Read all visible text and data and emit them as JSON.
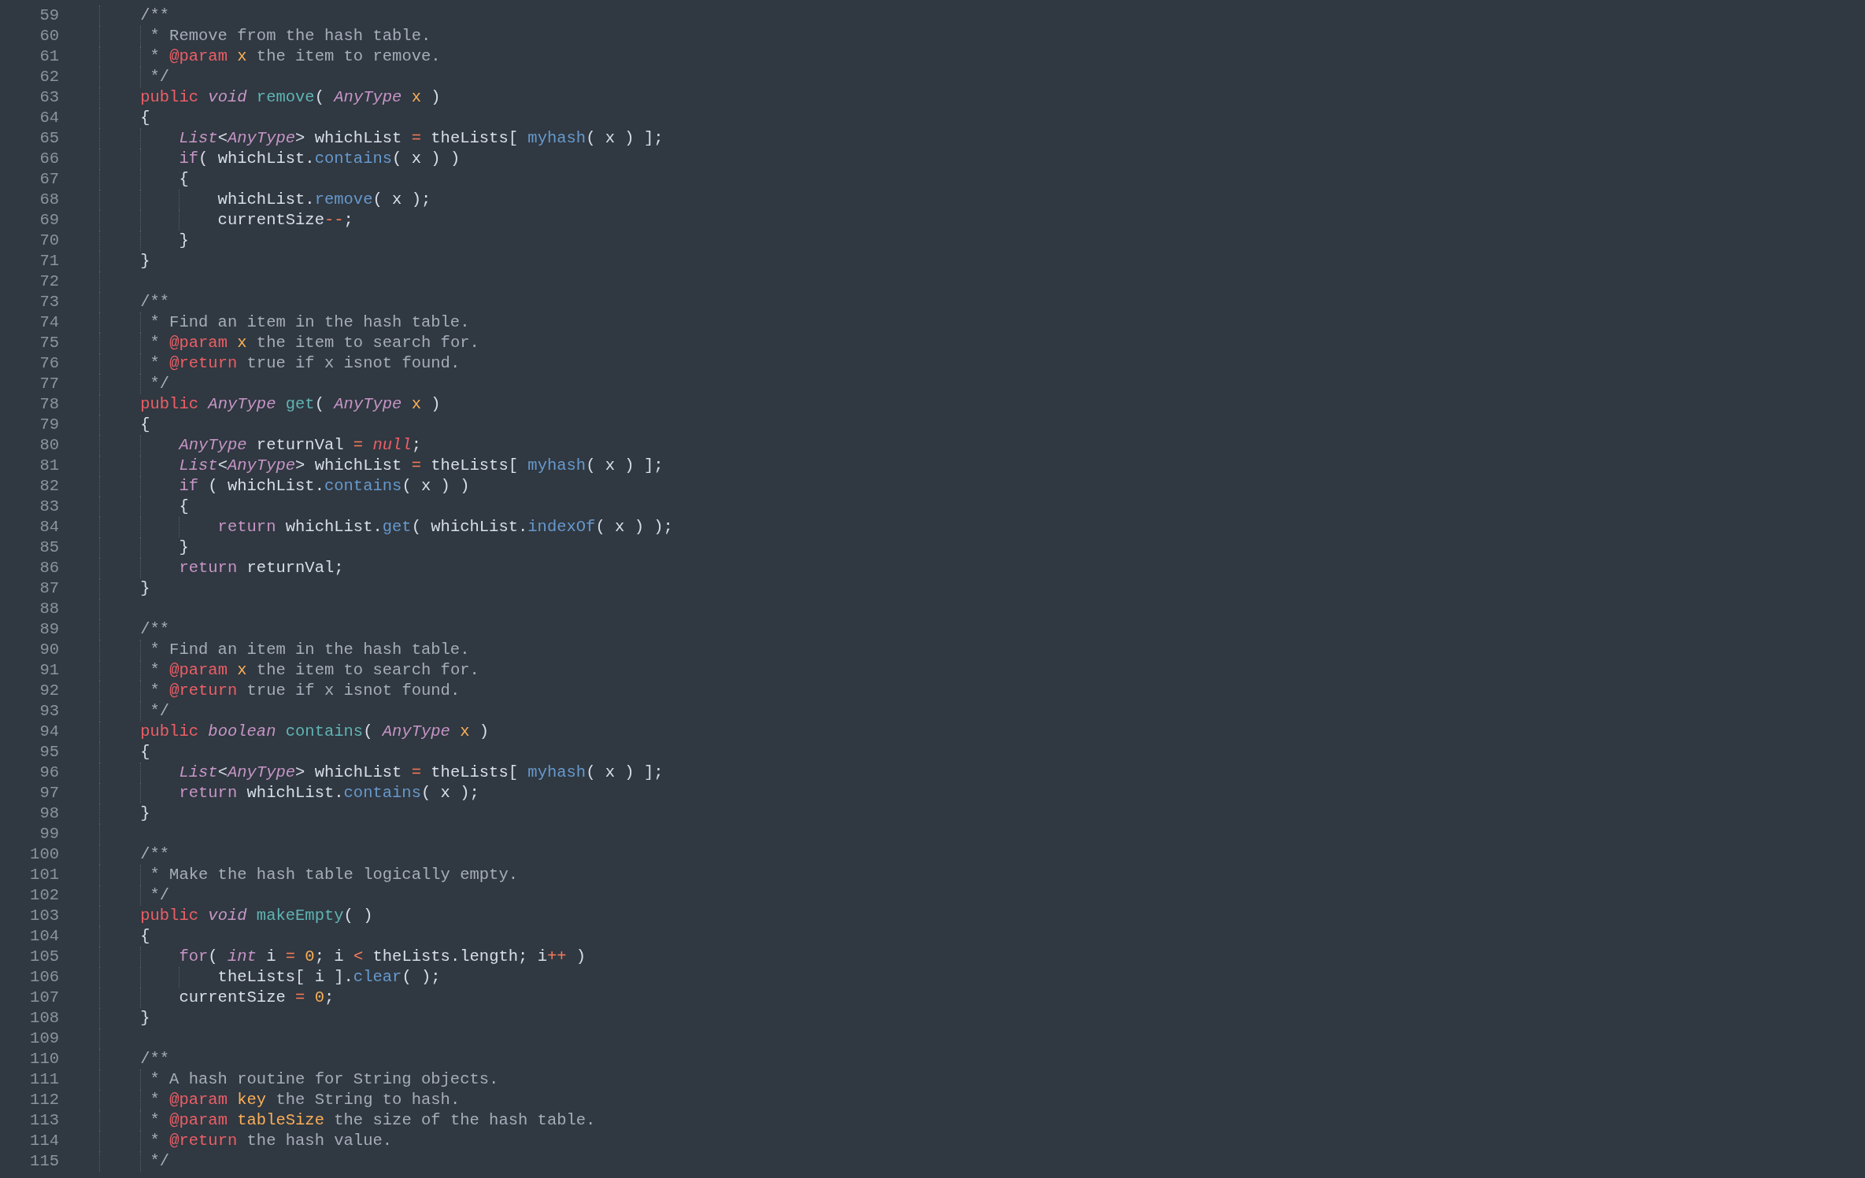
{
  "editor": {
    "lines": [
      {
        "number": "59",
        "tokens": [
          {
            "text": "    /**",
            "kind": "comment"
          }
        ]
      },
      {
        "number": "60",
        "tokens": [
          {
            "text": "     * Remove from the hash table.",
            "kind": "comment"
          }
        ]
      },
      {
        "number": "61",
        "tokens": [
          {
            "text": "     * ",
            "kind": "comment"
          },
          {
            "text": "@param",
            "kind": "tag"
          },
          {
            "text": " x",
            "kind": "param"
          },
          {
            "text": " the item to remove.",
            "kind": "comment"
          }
        ]
      },
      {
        "number": "62",
        "tokens": [
          {
            "text": "     */",
            "kind": "comment"
          }
        ]
      },
      {
        "number": "63",
        "tokens": [
          {
            "text": "    public",
            "kind": "modifier"
          },
          {
            "text": " void",
            "kind": "type"
          },
          {
            "text": " remove",
            "kind": "function"
          },
          {
            "text": "( ",
            "kind": "plain"
          },
          {
            "text": "AnyType",
            "kind": "type"
          },
          {
            "text": " x",
            "kind": "param"
          },
          {
            "text": " )",
            "kind": "plain"
          }
        ]
      },
      {
        "number": "64",
        "tokens": [
          {
            "text": "    {",
            "kind": "plain"
          }
        ]
      },
      {
        "number": "65",
        "tokens": [
          {
            "text": "        List",
            "kind": "type"
          },
          {
            "text": "<",
            "kind": "plain"
          },
          {
            "text": "AnyType",
            "kind": "type"
          },
          {
            "text": "> whichList ",
            "kind": "plain"
          },
          {
            "text": "=",
            "kind": "operator"
          },
          {
            "text": " theLists[ ",
            "kind": "plain"
          },
          {
            "text": "myhash",
            "kind": "method"
          },
          {
            "text": "( x ) ];",
            "kind": "plain"
          }
        ]
      },
      {
        "number": "66",
        "tokens": [
          {
            "text": "        if",
            "kind": "keyword"
          },
          {
            "text": "( whichList.",
            "kind": "plain"
          },
          {
            "text": "contains",
            "kind": "method"
          },
          {
            "text": "( x ) )",
            "kind": "plain"
          }
        ]
      },
      {
        "number": "67",
        "tokens": [
          {
            "text": "        {",
            "kind": "plain"
          }
        ]
      },
      {
        "number": "68",
        "tokens": [
          {
            "text": "            whichList.",
            "kind": "plain"
          },
          {
            "text": "remove",
            "kind": "method"
          },
          {
            "text": "( x );",
            "kind": "plain"
          }
        ]
      },
      {
        "number": "69",
        "tokens": [
          {
            "text": "            currentSize",
            "kind": "plain"
          },
          {
            "text": "--",
            "kind": "operator"
          },
          {
            "text": ";",
            "kind": "plain"
          }
        ]
      },
      {
        "number": "70",
        "tokens": [
          {
            "text": "        }",
            "kind": "plain"
          }
        ]
      },
      {
        "number": "71",
        "tokens": [
          {
            "text": "    }",
            "kind": "plain"
          }
        ]
      },
      {
        "number": "72"
      },
      {
        "number": "73",
        "tokens": [
          {
            "text": "    /**",
            "kind": "comment"
          }
        ]
      },
      {
        "number": "74",
        "tokens": [
          {
            "text": "     * Find an item in the hash table.",
            "kind": "comment"
          }
        ]
      },
      {
        "number": "75",
        "tokens": [
          {
            "text": "     * ",
            "kind": "comment"
          },
          {
            "text": "@param",
            "kind": "tag"
          },
          {
            "text": " x",
            "kind": "param"
          },
          {
            "text": " the item to search for.",
            "kind": "comment"
          }
        ]
      },
      {
        "number": "76",
        "tokens": [
          {
            "text": "     * ",
            "kind": "comment"
          },
          {
            "text": "@return",
            "kind": "tag"
          },
          {
            "text": " true if x isnot found.",
            "kind": "comment"
          }
        ]
      },
      {
        "number": "77",
        "tokens": [
          {
            "text": "     */",
            "kind": "comment"
          }
        ]
      },
      {
        "number": "78",
        "tokens": [
          {
            "text": "    public",
            "kind": "modifier"
          },
          {
            "text": " AnyType",
            "kind": "type"
          },
          {
            "text": " get",
            "kind": "function"
          },
          {
            "text": "( ",
            "kind": "plain"
          },
          {
            "text": "AnyType",
            "kind": "type"
          },
          {
            "text": " x",
            "kind": "param"
          },
          {
            "text": " )",
            "kind": "plain"
          }
        ]
      },
      {
        "number": "79",
        "tokens": [
          {
            "text": "    {",
            "kind": "plain"
          }
        ]
      },
      {
        "number": "80",
        "tokens": [
          {
            "text": "        AnyType",
            "kind": "type"
          },
          {
            "text": " returnVal ",
            "kind": "plain"
          },
          {
            "text": "=",
            "kind": "operator"
          },
          {
            "text": " null",
            "kind": "constant"
          },
          {
            "text": ";",
            "kind": "plain"
          }
        ]
      },
      {
        "number": "81",
        "tokens": [
          {
            "text": "        List",
            "kind": "type"
          },
          {
            "text": "<",
            "kind": "plain"
          },
          {
            "text": "AnyType",
            "kind": "type"
          },
          {
            "text": "> whichList ",
            "kind": "plain"
          },
          {
            "text": "=",
            "kind": "operator"
          },
          {
            "text": " theLists[ ",
            "kind": "plain"
          },
          {
            "text": "myhash",
            "kind": "method"
          },
          {
            "text": "( x ) ];",
            "kind": "plain"
          }
        ]
      },
      {
        "number": "82",
        "tokens": [
          {
            "text": "        if",
            "kind": "keyword"
          },
          {
            "text": " ( whichList.",
            "kind": "plain"
          },
          {
            "text": "contains",
            "kind": "method"
          },
          {
            "text": "( x ) )",
            "kind": "plain"
          }
        ]
      },
      {
        "number": "83",
        "tokens": [
          {
            "text": "        {",
            "kind": "plain"
          }
        ]
      },
      {
        "number": "84",
        "tokens": [
          {
            "text": "            return",
            "kind": "keyword"
          },
          {
            "text": " whichList.",
            "kind": "plain"
          },
          {
            "text": "get",
            "kind": "method"
          },
          {
            "text": "( whichList.",
            "kind": "plain"
          },
          {
            "text": "indexOf",
            "kind": "method"
          },
          {
            "text": "( x ) );",
            "kind": "plain"
          }
        ]
      },
      {
        "number": "85",
        "tokens": [
          {
            "text": "        }",
            "kind": "plain"
          }
        ]
      },
      {
        "number": "86",
        "tokens": [
          {
            "text": "        return",
            "kind": "keyword"
          },
          {
            "text": " returnVal;",
            "kind": "plain"
          }
        ]
      },
      {
        "number": "87",
        "tokens": [
          {
            "text": "    }",
            "kind": "plain"
          }
        ]
      },
      {
        "number": "88"
      },
      {
        "number": "89",
        "tokens": [
          {
            "text": "    /**",
            "kind": "comment"
          }
        ]
      },
      {
        "number": "90",
        "tokens": [
          {
            "text": "     * Find an item in the hash table.",
            "kind": "comment"
          }
        ]
      },
      {
        "number": "91",
        "tokens": [
          {
            "text": "     * ",
            "kind": "comment"
          },
          {
            "text": "@param",
            "kind": "tag"
          },
          {
            "text": " x",
            "kind": "param"
          },
          {
            "text": " the item to search for.",
            "kind": "comment"
          }
        ]
      },
      {
        "number": "92",
        "tokens": [
          {
            "text": "     * ",
            "kind": "comment"
          },
          {
            "text": "@return",
            "kind": "tag"
          },
          {
            "text": " true if x isnot found.",
            "kind": "comment"
          }
        ]
      },
      {
        "number": "93",
        "tokens": [
          {
            "text": "     */",
            "kind": "comment"
          }
        ]
      },
      {
        "number": "94",
        "tokens": [
          {
            "text": "    public",
            "kind": "modifier"
          },
          {
            "text": " boolean",
            "kind": "type"
          },
          {
            "text": " contains",
            "kind": "function"
          },
          {
            "text": "( ",
            "kind": "plain"
          },
          {
            "text": "AnyType",
            "kind": "type"
          },
          {
            "text": " x",
            "kind": "param"
          },
          {
            "text": " )",
            "kind": "plain"
          }
        ]
      },
      {
        "number": "95",
        "tokens": [
          {
            "text": "    {",
            "kind": "plain"
          }
        ]
      },
      {
        "number": "96",
        "tokens": [
          {
            "text": "        List",
            "kind": "type"
          },
          {
            "text": "<",
            "kind": "plain"
          },
          {
            "text": "AnyType",
            "kind": "type"
          },
          {
            "text": "> whichList ",
            "kind": "plain"
          },
          {
            "text": "=",
            "kind": "operator"
          },
          {
            "text": " theLists[ ",
            "kind": "plain"
          },
          {
            "text": "myhash",
            "kind": "method"
          },
          {
            "text": "( x ) ];",
            "kind": "plain"
          }
        ]
      },
      {
        "number": "97",
        "tokens": [
          {
            "text": "        return",
            "kind": "keyword"
          },
          {
            "text": " whichList.",
            "kind": "plain"
          },
          {
            "text": "contains",
            "kind": "method"
          },
          {
            "text": "( x );",
            "kind": "plain"
          }
        ]
      },
      {
        "number": "98",
        "tokens": [
          {
            "text": "    }",
            "kind": "plain"
          }
        ]
      },
      {
        "number": "99"
      },
      {
        "number": "100",
        "tokens": [
          {
            "text": "    /**",
            "kind": "comment"
          }
        ]
      },
      {
        "number": "101",
        "tokens": [
          {
            "text": "     * Make the hash table logically empty.",
            "kind": "comment"
          }
        ]
      },
      {
        "number": "102",
        "tokens": [
          {
            "text": "     */",
            "kind": "comment"
          }
        ]
      },
      {
        "number": "103",
        "tokens": [
          {
            "text": "    public",
            "kind": "modifier"
          },
          {
            "text": " void",
            "kind": "type"
          },
          {
            "text": " makeEmpty",
            "kind": "function"
          },
          {
            "text": "( )",
            "kind": "plain"
          }
        ]
      },
      {
        "number": "104",
        "tokens": [
          {
            "text": "    {",
            "kind": "plain"
          }
        ]
      },
      {
        "number": "105",
        "tokens": [
          {
            "text": "        for",
            "kind": "keyword"
          },
          {
            "text": "( ",
            "kind": "plain"
          },
          {
            "text": "int",
            "kind": "type"
          },
          {
            "text": " i ",
            "kind": "plain"
          },
          {
            "text": "=",
            "kind": "operator"
          },
          {
            "text": " 0",
            "kind": "number"
          },
          {
            "text": "; i ",
            "kind": "plain"
          },
          {
            "text": "<",
            "kind": "operator"
          },
          {
            "text": " theLists.length; i",
            "kind": "plain"
          },
          {
            "text": "++",
            "kind": "operator"
          },
          {
            "text": " )",
            "kind": "plain"
          }
        ]
      },
      {
        "number": "106",
        "tokens": [
          {
            "text": "            theLists[ i ].",
            "kind": "plain"
          },
          {
            "text": "clear",
            "kind": "method"
          },
          {
            "text": "( );",
            "kind": "plain"
          }
        ]
      },
      {
        "number": "107",
        "tokens": [
          {
            "text": "        currentSize ",
            "kind": "plain"
          },
          {
            "text": "=",
            "kind": "operator"
          },
          {
            "text": " 0",
            "kind": "number"
          },
          {
            "text": ";",
            "kind": "plain"
          }
        ]
      },
      {
        "number": "108",
        "tokens": [
          {
            "text": "    }",
            "kind": "plain"
          }
        ]
      },
      {
        "number": "109"
      },
      {
        "number": "110",
        "tokens": [
          {
            "text": "    /**",
            "kind": "comment"
          }
        ]
      },
      {
        "number": "111",
        "tokens": [
          {
            "text": "     * A hash routine for String objects.",
            "kind": "comment"
          }
        ]
      },
      {
        "number": "112",
        "tokens": [
          {
            "text": "     * ",
            "kind": "comment"
          },
          {
            "text": "@param",
            "kind": "tag"
          },
          {
            "text": " key",
            "kind": "param"
          },
          {
            "text": " the String to hash.",
            "kind": "comment"
          }
        ]
      },
      {
        "number": "113",
        "tokens": [
          {
            "text": "     * ",
            "kind": "comment"
          },
          {
            "text": "@param",
            "kind": "tag"
          },
          {
            "text": " tableSize",
            "kind": "param"
          },
          {
            "text": " the size of the hash table.",
            "kind": "comment"
          }
        ]
      },
      {
        "number": "114",
        "tokens": [
          {
            "text": "     * ",
            "kind": "comment"
          },
          {
            "text": "@return",
            "kind": "tag"
          },
          {
            "text": " the hash value.",
            "kind": "comment"
          }
        ]
      },
      {
        "number": "115",
        "tokens": [
          {
            "text": "     */",
            "kind": "comment"
          }
        ]
      }
    ]
  }
}
